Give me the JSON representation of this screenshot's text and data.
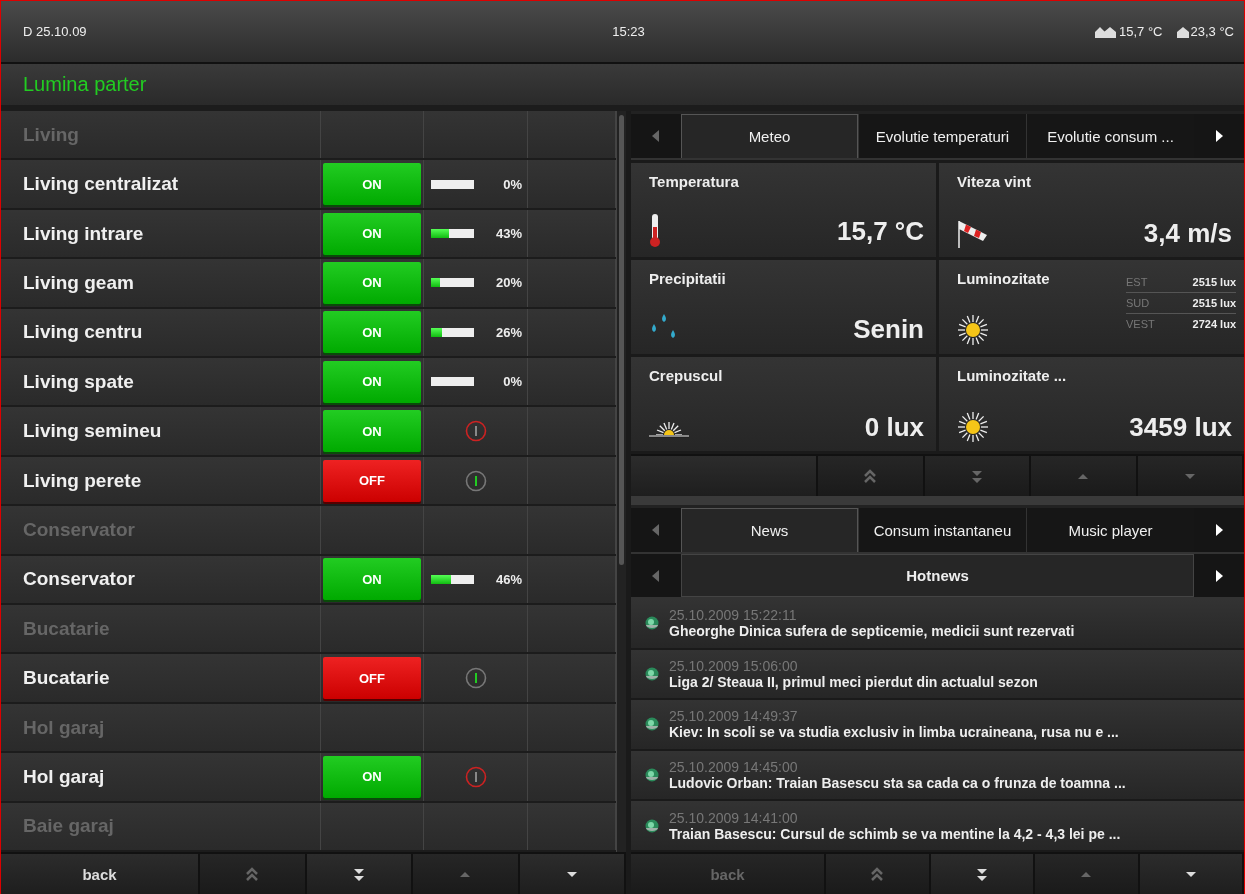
{
  "top_bar": {
    "date": "D 25.10.09",
    "time": "15:23",
    "temperatures": [
      {
        "kind": "outdoor",
        "value": "15,7 °C"
      },
      {
        "kind": "indoor",
        "value": "23,3 °C"
      }
    ]
  },
  "page_title": "Lumina parter",
  "lights": {
    "rows": [
      {
        "kind": "header",
        "name": "Living"
      },
      {
        "kind": "dimmer",
        "name": "Living centralizat",
        "button": "ON",
        "on": true,
        "level": 0,
        "reading": "0%"
      },
      {
        "kind": "dimmer",
        "name": "Living intrare",
        "button": "ON",
        "on": true,
        "level": 0.43,
        "reading": "43%"
      },
      {
        "kind": "dimmer",
        "name": "Living geam",
        "button": "ON",
        "on": true,
        "level": 0.2,
        "reading": "20%"
      },
      {
        "kind": "dimmer",
        "name": "Living centru",
        "button": "ON",
        "on": true,
        "level": 0.26,
        "reading": "26%"
      },
      {
        "kind": "dimmer",
        "name": "Living spate",
        "button": "ON",
        "on": true,
        "level": 0,
        "reading": "0%"
      },
      {
        "kind": "switch",
        "name": "Living semineu",
        "button": "ON",
        "on": true
      },
      {
        "kind": "switch",
        "name": "Living perete",
        "button": "OFF",
        "on": false
      },
      {
        "kind": "header",
        "name": "Conservator"
      },
      {
        "kind": "dimmer",
        "name": "Conservator",
        "button": "ON",
        "on": true,
        "level": 0.46,
        "reading": "46%"
      },
      {
        "kind": "header",
        "name": "Bucatarie"
      },
      {
        "kind": "switch",
        "name": "Bucatarie",
        "button": "OFF",
        "on": false
      },
      {
        "kind": "header",
        "name": "Hol garaj"
      },
      {
        "kind": "switch",
        "name": "Hol garaj",
        "button": "ON",
        "on": true
      },
      {
        "kind": "header",
        "name": "Baie garaj"
      }
    ],
    "nav": [
      {
        "kind": "back",
        "label": "back",
        "disabled": false
      },
      {
        "kind": "first",
        "disabled": true
      },
      {
        "kind": "last",
        "disabled": false
      },
      {
        "kind": "up",
        "disabled": true
      },
      {
        "kind": "down",
        "disabled": false
      }
    ]
  },
  "weather_widget": {
    "tabs": [
      {
        "label": "Meteo",
        "selected": true
      },
      {
        "label": "Evolutie temperaturi",
        "selected": false
      },
      {
        "label": "Evolutie consum ...",
        "selected": false
      }
    ],
    "cells": [
      {
        "kind": "temperature",
        "title": "Temperatura",
        "value": "15,7 °C"
      },
      {
        "kind": "wind",
        "title": "Viteza vint",
        "value": "3,4 m/s"
      },
      {
        "kind": "precipitation",
        "title": "Precipitatii",
        "value": "Senin"
      },
      {
        "kind": "brightness",
        "title": "Luminozitate",
        "sides": [
          {
            "side": "EST",
            "value": "2515 lux"
          },
          {
            "side": "SUD",
            "value": "2515 lux"
          },
          {
            "side": "VEST",
            "value": "2724 lux"
          }
        ]
      },
      {
        "kind": "twilight",
        "title": "Crepuscul",
        "value": "0 lux"
      },
      {
        "kind": "brightness",
        "title": "Luminozitate ...",
        "value": "3459 lux"
      }
    ],
    "nav": [
      {
        "kind": "blank"
      },
      {
        "kind": "first",
        "disabled": true
      },
      {
        "kind": "last",
        "disabled": true
      },
      {
        "kind": "up",
        "disabled": true
      },
      {
        "kind": "down",
        "disabled": true
      }
    ]
  },
  "news_widget": {
    "tabs": [
      {
        "label": "News",
        "selected": true
      },
      {
        "label": "Consum instantaneu",
        "selected": false
      },
      {
        "label": "Music player",
        "selected": false
      }
    ],
    "source": "Hotnews",
    "items": [
      {
        "time": "25.10.2009 15:22:11",
        "headline": "Gheorghe Dinica sufera de septicemie, medicii sunt rezervati"
      },
      {
        "time": "25.10.2009 15:06:00",
        "headline": "Liga 2/ Steaua II, primul meci pierdut din actualul sezon"
      },
      {
        "time": "25.10.2009 14:49:37",
        "headline": "Kiev: In scoli se va studia exclusiv in limba ucraineana, rusa nu e ..."
      },
      {
        "time": "25.10.2009 14:45:00",
        "headline": "Ludovic Orban: Traian Basescu sta sa cada ca o frunza de toamna ..."
      },
      {
        "time": "25.10.2009 14:41:00",
        "headline": "Traian Basescu: Cursul de schimb se va mentine la 4,2 - 4,3 lei pe ..."
      }
    ],
    "nav": [
      {
        "kind": "back",
        "label": "back",
        "disabled": true
      },
      {
        "kind": "first",
        "disabled": true
      },
      {
        "kind": "last",
        "disabled": false
      },
      {
        "kind": "up",
        "disabled": true
      },
      {
        "kind": "down",
        "disabled": false
      }
    ]
  }
}
